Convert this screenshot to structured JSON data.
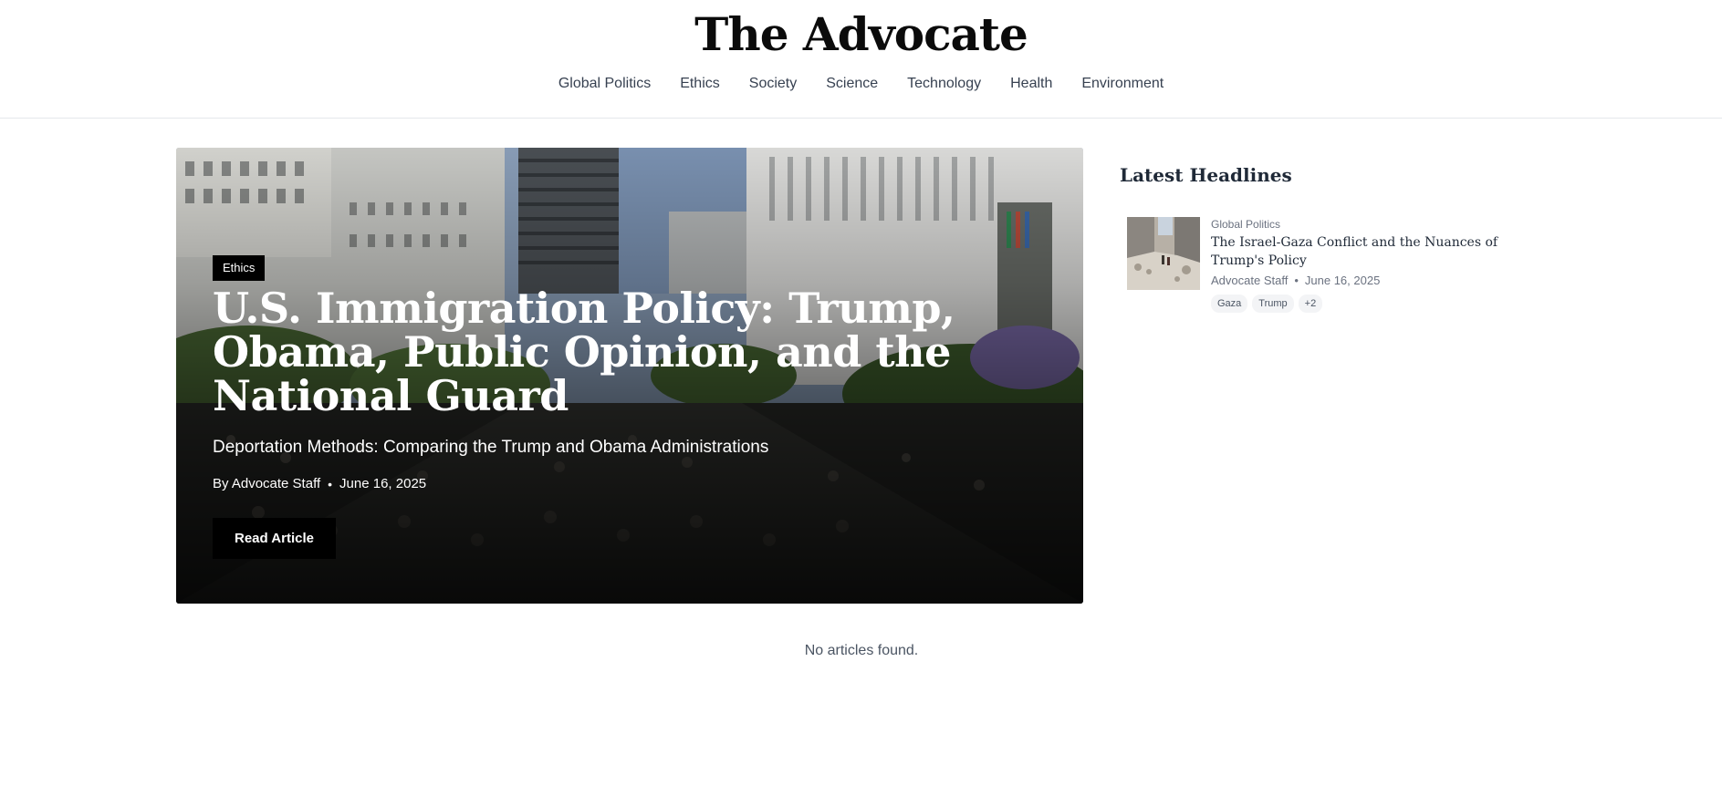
{
  "site": {
    "title": "The Advocate"
  },
  "nav": {
    "items": [
      "Global Politics",
      "Ethics",
      "Society",
      "Science",
      "Technology",
      "Health",
      "Environment"
    ]
  },
  "hero": {
    "category": "Ethics",
    "title": "U.S. Immigration Policy: Trump, Obama, Public Opinion, and the National Guard",
    "subtitle": "Deportation Methods: Comparing the Trump and Obama Administrations",
    "author": "By Advocate Staff",
    "separator": "•",
    "date": "June 16, 2025",
    "button_label": "Read Article"
  },
  "main": {
    "empty_message": "No articles found."
  },
  "sidebar": {
    "title": "Latest Headlines",
    "items": [
      {
        "category": "Global Politics",
        "title": "The Israel-Gaza Conflict and the Nuances of Trump's Policy",
        "author": "Advocate Staff",
        "separator": "•",
        "date": "June 16, 2025",
        "tags": [
          "Gaza",
          "Trump",
          "+2"
        ]
      }
    ]
  },
  "colors": {
    "text": "#1f2937",
    "muted": "#6b7280",
    "badge": "#000000",
    "tag_bg": "#f3f4f6"
  }
}
